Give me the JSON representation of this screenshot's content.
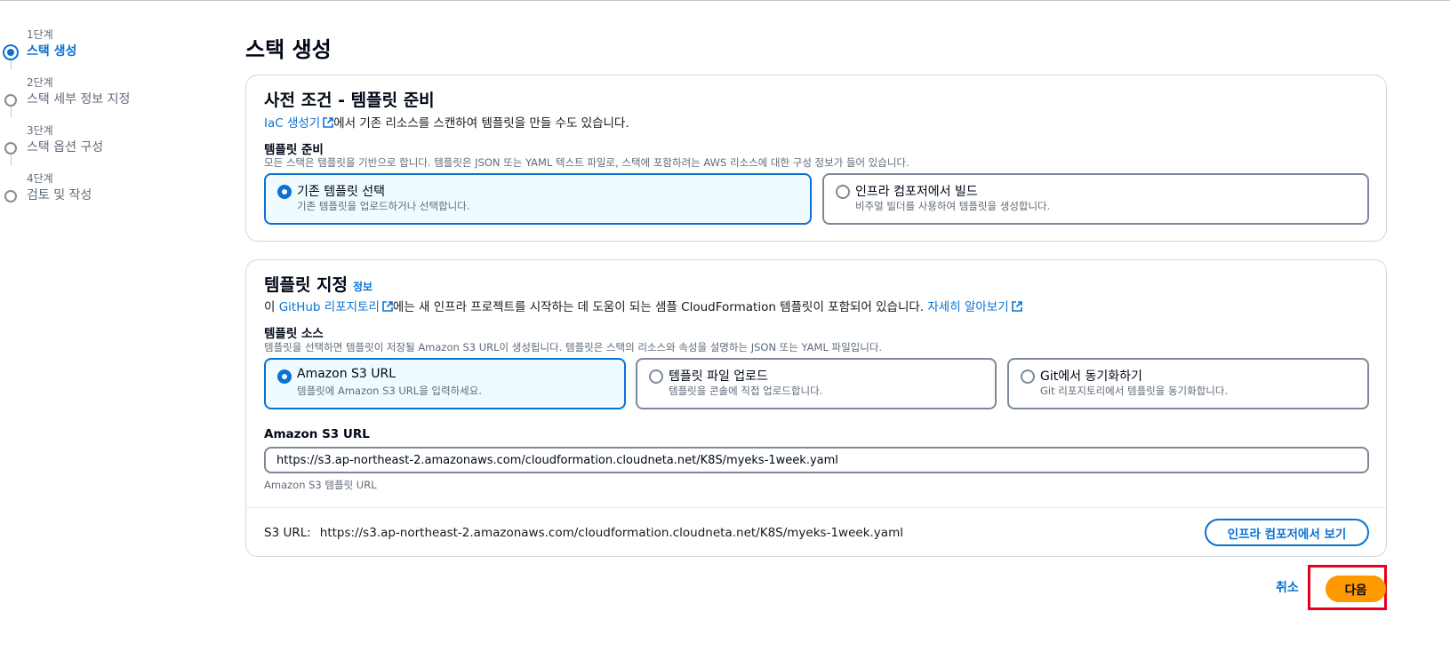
{
  "steps": [
    {
      "num": "1단계",
      "name": "스택 생성",
      "active": true
    },
    {
      "num": "2단계",
      "name": "스택 세부 정보 지정",
      "active": false
    },
    {
      "num": "3단계",
      "name": "스택 옵션 구성",
      "active": false
    },
    {
      "num": "4단계",
      "name": "검토 및 작성",
      "active": false
    }
  ],
  "page": {
    "title": "스택 생성"
  },
  "prereq": {
    "title": "사전 조건 - 템플릿 준비",
    "desc_link": "IaC 생성기",
    "desc_rest": "에서 기존 리소스를 스캔하여 템플릿을 만들 수도 있습니다.",
    "field_label": "템플릿 준비",
    "field_desc": "모든 스택은 템플릿을 기반으로 합니다. 템플릿은 JSON 또는 YAML 텍스트 파일로, 스택에 포함하려는 AWS 리소스에 대한 구성 정보가 들어 있습니다.",
    "options": [
      {
        "label": "기존 템플릿 선택",
        "desc": "기존 템플릿을 업로드하거나 선택합니다.",
        "selected": true
      },
      {
        "label": "인프라 컴포저에서 빌드",
        "desc": "비주얼 빌더를 사용하여 템플릿을 생성합니다.",
        "selected": false
      }
    ]
  },
  "template": {
    "title": "템플릿 지정",
    "info": "정보",
    "desc_prefix": "이 ",
    "desc_link": "GitHub 리포지토리",
    "desc_middle": "에는 새 인프라 프로젝트를 시작하는 데 도움이 되는 샘플 CloudFormation 템플릿이 포함되어 있습니다.",
    "learn_more": "자세히 알아보기",
    "source_label": "템플릿 소스",
    "source_desc": "템플릿을 선택하면 템플릿이 저장될 Amazon S3 URL이 생성됩니다. 템플릿은 스택의 리소스와 속성을 설명하는 JSON 또는 YAML 파일입니다.",
    "sources": [
      {
        "label": "Amazon S3 URL",
        "desc": "템플릿에 Amazon S3 URL을 입력하세요.",
        "selected": true
      },
      {
        "label": "템플릿 파일 업로드",
        "desc": "템플릿을 콘솔에 직접 업로드합니다.",
        "selected": false
      },
      {
        "label": "Git에서 동기화하기",
        "desc": "Git 리포지토리에서 템플릿을 동기화합니다.",
        "selected": false
      }
    ],
    "url_label": "Amazon S3 URL",
    "url_value": "https://s3.ap-northeast-2.amazonaws.com/cloudformation.cloudneta.net/K8S/myeks-1week.yaml",
    "url_hint": "Amazon S3 템플릿 URL",
    "summary_label": "S3 URL:",
    "summary_value": "https://s3.ap-northeast-2.amazonaws.com/cloudformation.cloudneta.net/K8S/myeks-1week.yaml",
    "composer_button": "인프라 컴포저에서 보기"
  },
  "footer": {
    "cancel": "취소",
    "next": "다음"
  },
  "colors": {
    "accent": "#0972d3",
    "primary_button": "#ff9900",
    "highlight_box": "#e6001e"
  },
  "icons": {
    "external": "external-link-icon"
  }
}
